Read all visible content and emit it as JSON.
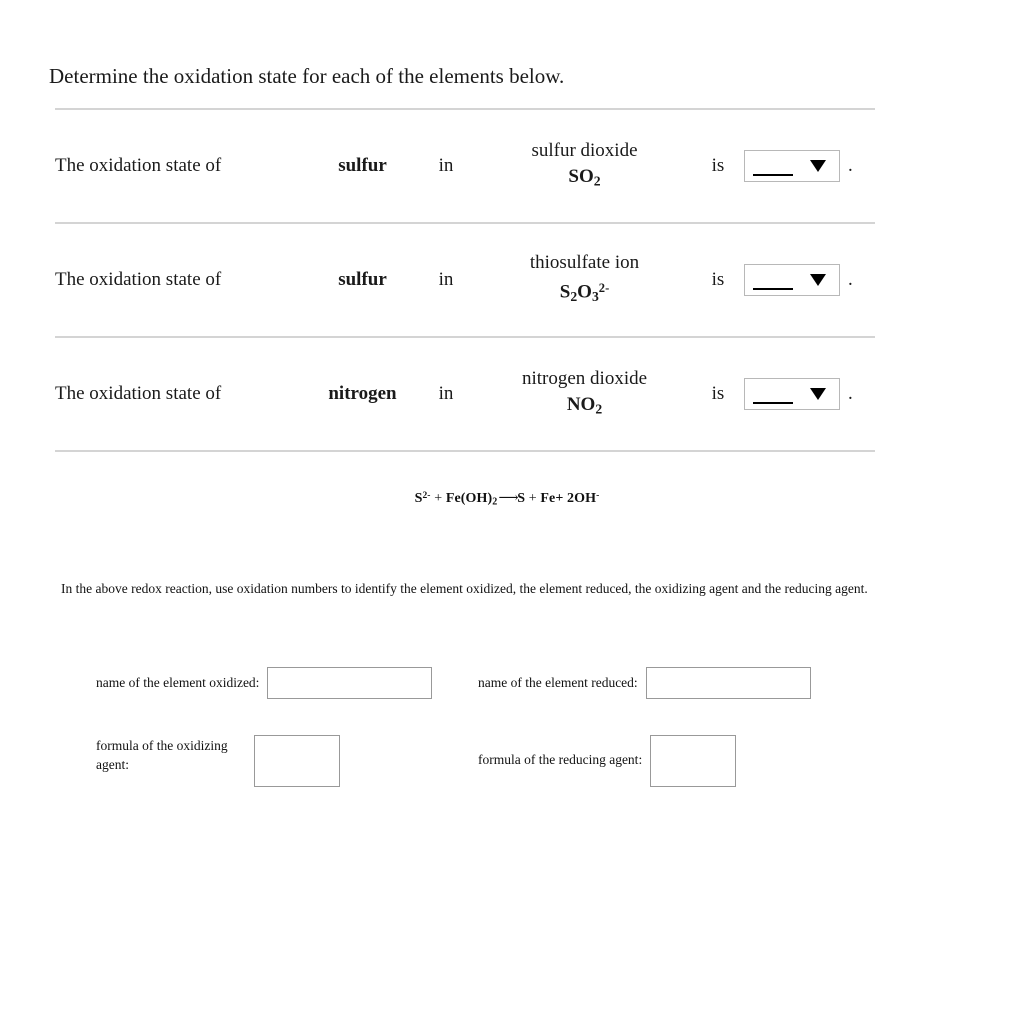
{
  "heading": "Determine the oxidation state for each of the elements below.",
  "oxidation_table": {
    "rows": [
      {
        "lead": "The oxidation state of",
        "element": "sulfur",
        "in": "in",
        "compound_name": "sulfur dioxide",
        "compound_formula_main": "SO",
        "compound_formula_sub": "2",
        "compound_formula_sup": "",
        "is": "is",
        "answer_value": "",
        "dropdown_icon": "chevron-down-icon",
        "period": "."
      },
      {
        "lead": "The oxidation state of",
        "element": "sulfur",
        "in": "in",
        "compound_name": "thiosulfate ion",
        "compound_formula_main": "S",
        "compound_formula_sub": "2",
        "compound_formula_sub2": "3",
        "compound_formula_mid": "O",
        "compound_formula_sup": "2-",
        "is": "is",
        "answer_value": "",
        "dropdown_icon": "chevron-down-icon",
        "period": "."
      },
      {
        "lead": "The oxidation state of",
        "element": "nitrogen",
        "in": "in",
        "compound_name": "nitrogen dioxide",
        "compound_formula_main": "NO",
        "compound_formula_sub": "2",
        "compound_formula_sup": "",
        "is": "is",
        "answer_value": "",
        "dropdown_icon": "chevron-down-icon",
        "period": "."
      }
    ]
  },
  "equation": {
    "reactant1_main": "S",
    "reactant1_sup": "2-",
    "plus1": "+",
    "reactant2_main": "Fe(OH)",
    "reactant2_sub": "2",
    "arrow": "⟶",
    "product1": "S",
    "plus2": "+",
    "product2": "Fe+",
    "product3_main": "2OH",
    "product3_sup": "-"
  },
  "redox_instruction": "In the above redox reaction, use oxidation numbers to identify the element oxidized, the element reduced, the oxidizing agent and the reducing agent.",
  "fields": {
    "element_oxidized": {
      "label": "name of the element oxidized:",
      "value": "",
      "placeholder": ""
    },
    "element_reduced": {
      "label": "name of the element reduced:",
      "value": "",
      "placeholder": ""
    },
    "oxidizing_agent": {
      "label_line1": "formula of the oxidizing",
      "label_line2": "agent:",
      "value": "",
      "placeholder": ""
    },
    "reducing_agent": {
      "label": "formula of the reducing agent:",
      "value": "",
      "placeholder": ""
    }
  },
  "colors": {
    "rule": "#d4d4d4",
    "input_border": "#999999",
    "dropdown_border": "#b8b8b8",
    "text": "#111111",
    "background": "#ffffff"
  }
}
